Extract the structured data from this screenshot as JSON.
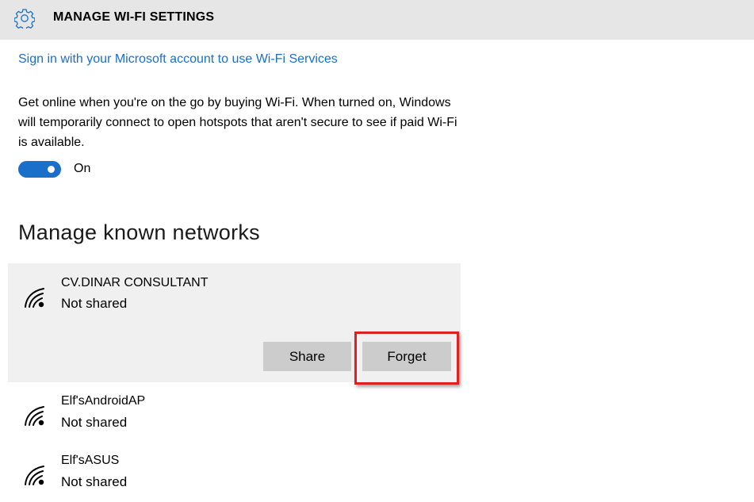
{
  "header": {
    "title": "MANAGE WI-FI SETTINGS",
    "icon": "gear-icon"
  },
  "signin_link": "Sign in with your Microsoft account to use Wi-Fi Services",
  "description": "Get online when you're on the go by buying Wi-Fi. When turned on, Windows will temporarily connect to open hotspots that aren't secure to see if paid Wi-Fi is available.",
  "toggle": {
    "label": "On",
    "state": true
  },
  "section_title": "Manage known networks",
  "networks": [
    {
      "name": "CV.DINAR CONSULTANT",
      "status": "Not shared",
      "icon": "wifi-icon",
      "selected": true
    },
    {
      "name": "Elf'sAndroidAP",
      "status": "Not shared",
      "icon": "wifi-icon"
    },
    {
      "name": "Elf'sASUS",
      "status": "Not shared",
      "icon": "wifi-icon"
    }
  ],
  "actions": {
    "share_label": "Share",
    "forget_label": "Forget"
  },
  "colors": {
    "accent": "#1a6fc9",
    "header_bg": "#e6e6e6",
    "selected_bg": "#f0f0f0",
    "button_bg": "#cccccc",
    "highlight": "#e02020"
  }
}
